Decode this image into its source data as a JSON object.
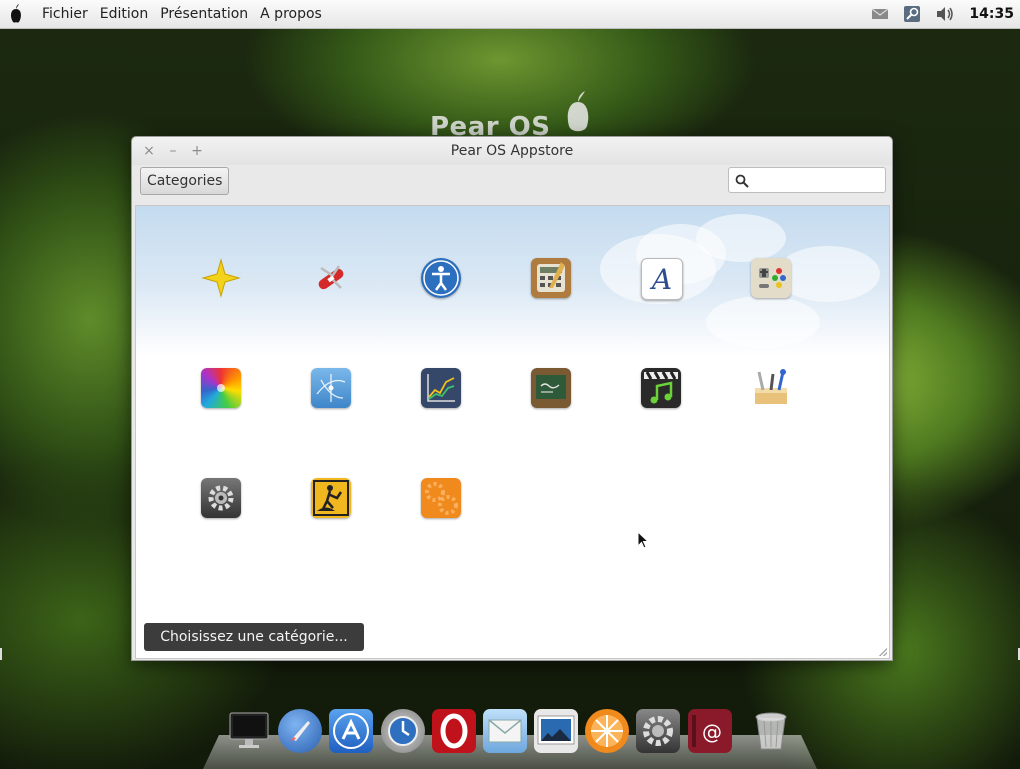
{
  "menubar": {
    "items": [
      "Fichier",
      "Edition",
      "Présentation",
      "A propos"
    ],
    "clock": "14:35",
    "tray_icons": [
      "mail-icon",
      "network-icon",
      "volume-icon"
    ]
  },
  "desktop": {
    "watermark_text": "Pear OS"
  },
  "window": {
    "title": "Pear OS Appstore",
    "close_symbol": "×",
    "minimize_symbol": "–",
    "maximize_symbol": "+",
    "categories_button": "Categories",
    "search": {
      "value": "",
      "placeholder": ""
    },
    "status_button": "Choisissez une catégorie...",
    "apps": [
      {
        "icon": "star-sparkle-icon",
        "color": "#f3d21a"
      },
      {
        "icon": "swiss-knife-icon",
        "color": "#d42a2a"
      },
      {
        "icon": "accessibility-icon",
        "color": "#2c6fbe"
      },
      {
        "icon": "calculator-icon",
        "color": "#b07b3e"
      },
      {
        "icon": "font-icon",
        "color": "#ffffff"
      },
      {
        "icon": "games-icon",
        "color": "#e2dcc8"
      },
      {
        "icon": "graphics-color-wheel-icon",
        "color": "#e04a8a"
      },
      {
        "icon": "internet-network-icon",
        "color": "#5fa4dc"
      },
      {
        "icon": "chart-office-icon",
        "color": "#36486a"
      },
      {
        "icon": "education-chalkboard-icon",
        "color": "#7a5a33"
      },
      {
        "icon": "multimedia-clapper-icon",
        "color": "#2a2a2a"
      },
      {
        "icon": "developer-tools-icon",
        "color": "#e8c27a"
      },
      {
        "icon": "system-gear-icon",
        "color": "#555555"
      },
      {
        "icon": "utilities-construction-icon",
        "color": "#f0b81e"
      },
      {
        "icon": "other-gears-icon",
        "color": "#f08a1c"
      }
    ]
  },
  "dock": {
    "items": [
      "display-icon",
      "rocket-launcher-icon",
      "appstore-icon",
      "time-machine-icon",
      "opera-browser-icon",
      "mail-icon",
      "photo-preview-icon",
      "music-player-icon",
      "system-preferences-icon",
      "address-book-icon",
      "trash-icon"
    ]
  }
}
